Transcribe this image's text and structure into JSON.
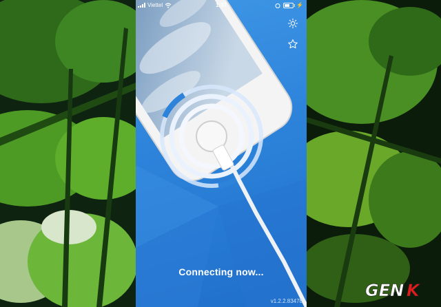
{
  "status_bar": {
    "carrier": "Viettel",
    "time": "1:37"
  },
  "icons": {
    "settings": "gear-icon",
    "favorites": "star-icon",
    "wifi": "wifi-icon",
    "battery": "battery-icon"
  },
  "main": {
    "status_text": "Connecting now...",
    "version": "v1.2.2.83478"
  },
  "watermark": {
    "text": "GENK"
  },
  "colors": {
    "phone_bg": "#2d83da",
    "accent_white": "#ffffff",
    "leaf_green": "#3f8a1c"
  }
}
